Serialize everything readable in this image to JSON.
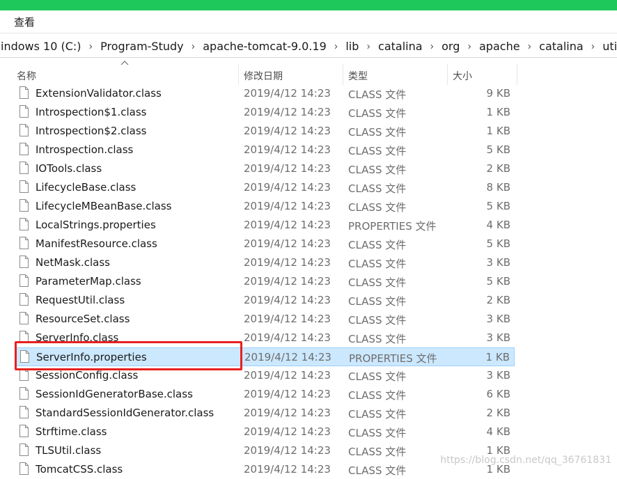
{
  "ribbon": {
    "tab_label": "查看"
  },
  "address": {
    "crumbs": [
      "indows 10 (C:)",
      "Program-Study",
      "apache-tomcat-9.0.19",
      "lib",
      "catalina",
      "org",
      "apache",
      "catalina",
      "util"
    ]
  },
  "columns": {
    "name": "名称",
    "date": "修改日期",
    "type": "类型",
    "size": "大小"
  },
  "files": [
    {
      "name": "ExtensionValidator.class",
      "date": "2019/4/12 14:23",
      "type": "CLASS 文件",
      "size": "9 KB"
    },
    {
      "name": "Introspection$1.class",
      "date": "2019/4/12 14:23",
      "type": "CLASS 文件",
      "size": "1 KB"
    },
    {
      "name": "Introspection$2.class",
      "date": "2019/4/12 14:23",
      "type": "CLASS 文件",
      "size": "1 KB"
    },
    {
      "name": "Introspection.class",
      "date": "2019/4/12 14:23",
      "type": "CLASS 文件",
      "size": "5 KB"
    },
    {
      "name": "IOTools.class",
      "date": "2019/4/12 14:23",
      "type": "CLASS 文件",
      "size": "2 KB"
    },
    {
      "name": "LifecycleBase.class",
      "date": "2019/4/12 14:23",
      "type": "CLASS 文件",
      "size": "8 KB"
    },
    {
      "name": "LifecycleMBeanBase.class",
      "date": "2019/4/12 14:23",
      "type": "CLASS 文件",
      "size": "5 KB"
    },
    {
      "name": "LocalStrings.properties",
      "date": "2019/4/12 14:23",
      "type": "PROPERTIES 文件",
      "size": "4 KB"
    },
    {
      "name": "ManifestResource.class",
      "date": "2019/4/12 14:23",
      "type": "CLASS 文件",
      "size": "5 KB"
    },
    {
      "name": "NetMask.class",
      "date": "2019/4/12 14:23",
      "type": "CLASS 文件",
      "size": "3 KB"
    },
    {
      "name": "ParameterMap.class",
      "date": "2019/4/12 14:23",
      "type": "CLASS 文件",
      "size": "5 KB"
    },
    {
      "name": "RequestUtil.class",
      "date": "2019/4/12 14:23",
      "type": "CLASS 文件",
      "size": "2 KB"
    },
    {
      "name": "ResourceSet.class",
      "date": "2019/4/12 14:23",
      "type": "CLASS 文件",
      "size": "3 KB"
    },
    {
      "name": "ServerInfo.class",
      "date": "2019/4/12 14:23",
      "type": "CLASS 文件",
      "size": "3 KB"
    },
    {
      "name": "ServerInfo.properties",
      "date": "2019/4/12 14:23",
      "type": "PROPERTIES 文件",
      "size": "1 KB",
      "selected": true
    },
    {
      "name": "SessionConfig.class",
      "date": "2019/4/12 14:23",
      "type": "CLASS 文件",
      "size": "3 KB"
    },
    {
      "name": "SessionIdGeneratorBase.class",
      "date": "2019/4/12 14:23",
      "type": "CLASS 文件",
      "size": "6 KB"
    },
    {
      "name": "StandardSessionIdGenerator.class",
      "date": "2019/4/12 14:23",
      "type": "CLASS 文件",
      "size": "2 KB"
    },
    {
      "name": "Strftime.class",
      "date": "2019/4/12 14:23",
      "type": "CLASS 文件",
      "size": "4 KB"
    },
    {
      "name": "TLSUtil.class",
      "date": "2019/4/12 14:23",
      "type": "CLASS 文件",
      "size": "1 KB"
    },
    {
      "name": "TomcatCSS.class",
      "date": "2019/4/12 14:23",
      "type": "CLASS 文件",
      "size": "1 KB"
    }
  ],
  "watermark": "https://blog.csdn.net/qq_36761831",
  "colors": {
    "topbar": "#1fc85a",
    "selection": "#cce8ff",
    "highlight": "#e8201f"
  }
}
